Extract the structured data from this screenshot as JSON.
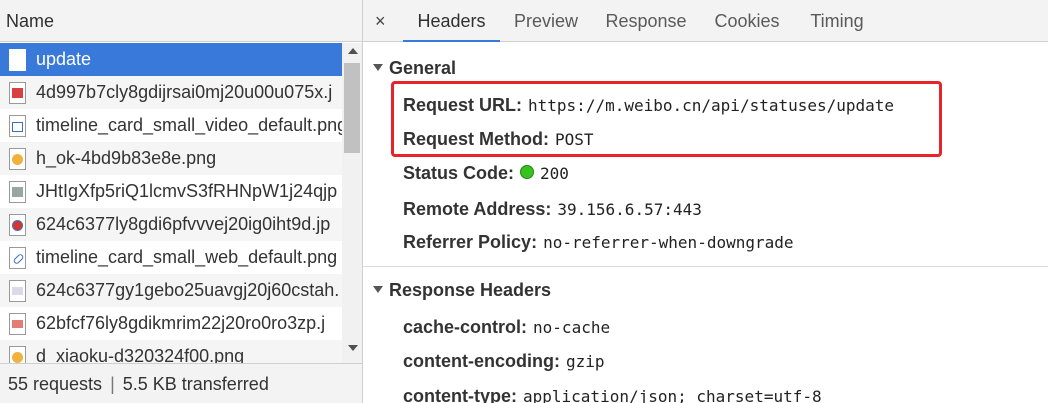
{
  "list": {
    "header": "Name",
    "requests": [
      {
        "name": "update",
        "icon": "document-icon",
        "selected": true
      },
      {
        "name": "4d997b7cly8gdijrsai0mj20u00u075x.j",
        "icon": "image-icon"
      },
      {
        "name": "timeline_card_small_video_default.png",
        "icon": "video-icon"
      },
      {
        "name": "h_ok-4bd9b83e8e.png",
        "icon": "emoji-icon"
      },
      {
        "name": "JHtIgXfp5riQ1lcmvS3fRHNpW1j24qjp",
        "icon": "image-icon"
      },
      {
        "name": "624c6377ly8gdi6pfvvvej20ig0iht9d.jp",
        "icon": "weibo-image-icon"
      },
      {
        "name": "timeline_card_small_web_default.png",
        "icon": "link-icon"
      },
      {
        "name": "624c6377gy1gebo25uavgj20j60cstah.",
        "icon": "image-icon"
      },
      {
        "name": "62bfcf76ly8gdikmrim22j20ro0ro3zp.j",
        "icon": "image-icon"
      },
      {
        "name": "d_xiaoku-d320324f00.png",
        "icon": "emoji-icon"
      }
    ],
    "status": {
      "requests": "55 requests",
      "separator": "|",
      "transferred": "5.5 KB transferred"
    }
  },
  "details": {
    "close_glyph": "×",
    "tabs": [
      "Headers",
      "Preview",
      "Response",
      "Cookies",
      "Timing"
    ],
    "active_tab": "Headers",
    "general": {
      "title": "General",
      "request_url_label": "Request URL:",
      "request_url": "https://m.weibo.cn/api/statuses/update",
      "request_method_label": "Request Method:",
      "request_method": "POST",
      "status_code_label": "Status Code:",
      "status_code": "200",
      "remote_address_label": "Remote Address:",
      "remote_address": "39.156.6.57:443",
      "referrer_policy_label": "Referrer Policy:",
      "referrer_policy": "no-referrer-when-downgrade"
    },
    "response_headers": {
      "title": "Response Headers",
      "items": [
        {
          "key": "cache-control:",
          "value": "no-cache"
        },
        {
          "key": "content-encoding:",
          "value": "gzip"
        },
        {
          "key": "content-type:",
          "value": "application/json; charset=utf-8"
        }
      ]
    }
  },
  "colors": {
    "selected_row": "#3879d9",
    "highlight_border": "#e8232a",
    "status_ok": "#39c21d"
  }
}
